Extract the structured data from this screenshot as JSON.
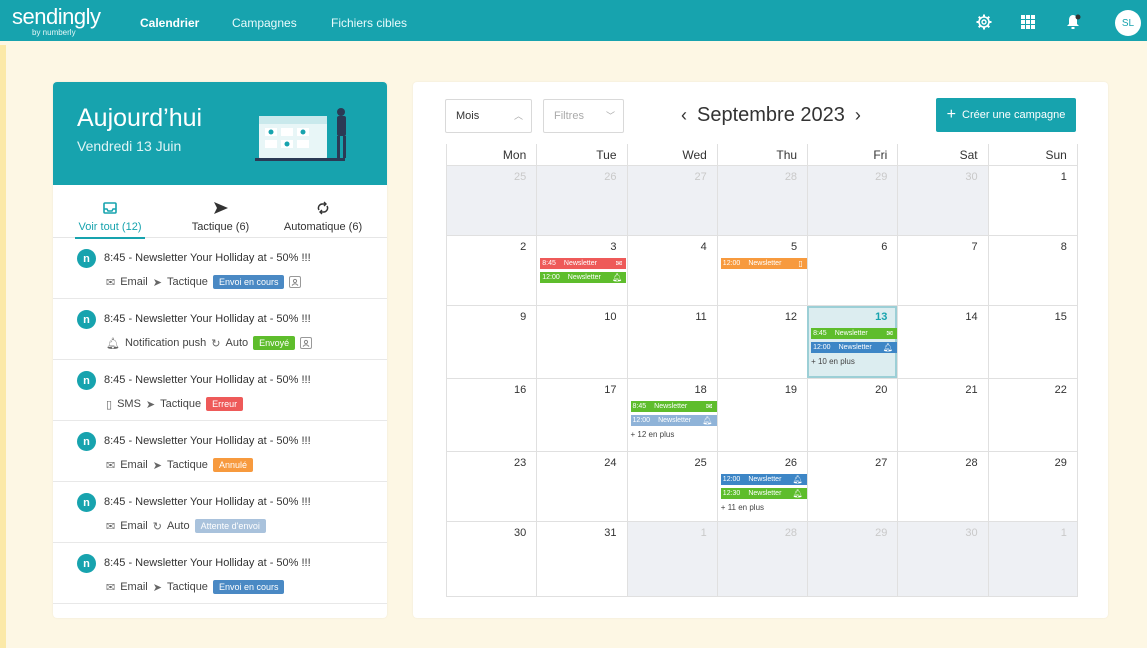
{
  "topbar": {
    "logo": "sendingly",
    "logo_sub": "by numberly",
    "nav": [
      "Calendrier",
      "Campagnes",
      "Fichiers cibles"
    ],
    "avatar": "SL"
  },
  "today": {
    "title": "Aujourd’hui",
    "date": "Vendredi 13 Juin"
  },
  "tabs": [
    {
      "label": "Voir tout (12)",
      "icon": "inbox-icon"
    },
    {
      "label": "Tactique (6)",
      "icon": "send-icon"
    },
    {
      "label": "Automatique (6)",
      "icon": "refresh-icon"
    }
  ],
  "events": [
    {
      "title": "8:45 - Newsletter Your Holliday at - 50% !!!",
      "channel": "Email",
      "channel_icon": "envelope-icon",
      "mode": "Tactique",
      "status": "Envoi en cours",
      "status_color": "#4a89c4"
    },
    {
      "title": "8:45 - Newsletter Your Holliday at - 50% !!!",
      "channel": "Notification push",
      "channel_icon": "bell-icon",
      "mode": "Auto",
      "status": "Envoyé",
      "status_color": "#5ebd2c"
    },
    {
      "title": "8:45 - Newsletter Your Holliday at - 50% !!!",
      "channel": "SMS",
      "channel_icon": "phone-icon",
      "mode": "Tactique",
      "status": "Erreur",
      "status_color": "#ee5a59"
    },
    {
      "title": "8:45 - Newsletter Your Holliday at - 50% !!!",
      "channel": "Email",
      "channel_icon": "envelope-icon",
      "mode": "Tactique",
      "status": "Annulé",
      "status_color": "#f79a3e"
    },
    {
      "title": "8:45 - Newsletter Your Holliday at - 50% !!!",
      "channel": "Email",
      "channel_icon": "envelope-icon",
      "mode": "Auto",
      "status": "Attente d'envoi",
      "status_color": "#a9c2dc"
    },
    {
      "title": "8:45 - Newsletter Your Holliday at - 50% !!!",
      "channel": "Email",
      "channel_icon": "envelope-icon",
      "mode": "Tactique",
      "status": "Envoi en cours",
      "status_color": "#4a89c4"
    }
  ],
  "calendar": {
    "view_select": "Mois",
    "filter_select": "Filtres",
    "month": "Septembre 2023",
    "create_label": "Créer une campagne",
    "weekdays": [
      "Mon",
      "Tue",
      "Wed",
      "Thu",
      "Fri",
      "Sat",
      "Sun"
    ],
    "weeks": [
      [
        "25",
        "26",
        "27",
        "28",
        "29",
        "30",
        "1"
      ],
      [
        "2",
        "3",
        "4",
        "5",
        "6",
        "7",
        "8"
      ],
      [
        "9",
        "10",
        "11",
        "12",
        "13",
        "14",
        "15"
      ],
      [
        "16",
        "17",
        "18",
        "19",
        "20",
        "21",
        "22"
      ],
      [
        "23",
        "24",
        "25",
        "26",
        "27",
        "28",
        "29"
      ],
      [
        "30",
        "31",
        "1",
        "28",
        "29",
        "30",
        "1"
      ]
    ],
    "cell_events": {
      "w1d1": [
        {
          "time": "8:45",
          "label": "Newsletter",
          "color": "red",
          "icon": "envelope-icon"
        },
        {
          "time": "12:00",
          "label": "Newsletter",
          "color": "green",
          "icon": "bell-icon"
        }
      ],
      "w1d3": [
        {
          "time": "12:00",
          "label": "Newsletter",
          "color": "orange",
          "icon": "phone-icon"
        }
      ],
      "w2d4": [
        {
          "time": "8:45",
          "label": "Newsletter",
          "color": "green",
          "icon": "envelope-icon"
        },
        {
          "time": "12:00",
          "label": "Newsletter",
          "color": "blue",
          "icon": "bell-icon"
        }
      ],
      "w3d2": [
        {
          "time": "8:45",
          "label": "Newsletter",
          "color": "green",
          "icon": "envelope-icon"
        },
        {
          "time": "12:00",
          "label": "Newsletter",
          "color": "lightblue",
          "icon": "bell-icon"
        }
      ],
      "w4d3": [
        {
          "time": "12:00",
          "label": "Newsletter",
          "color": "blue",
          "icon": "bell-icon"
        },
        {
          "time": "12:30",
          "label": "Newsletter",
          "color": "green",
          "icon": "bell-icon"
        }
      ]
    },
    "more": {
      "w2d4": "+ 10 en plus",
      "w3d2": "+ 12 en plus",
      "w4d3": "+ 11 en plus"
    }
  },
  "colors": {
    "brand": "#17a3ae",
    "background": "#fdf7e4"
  }
}
